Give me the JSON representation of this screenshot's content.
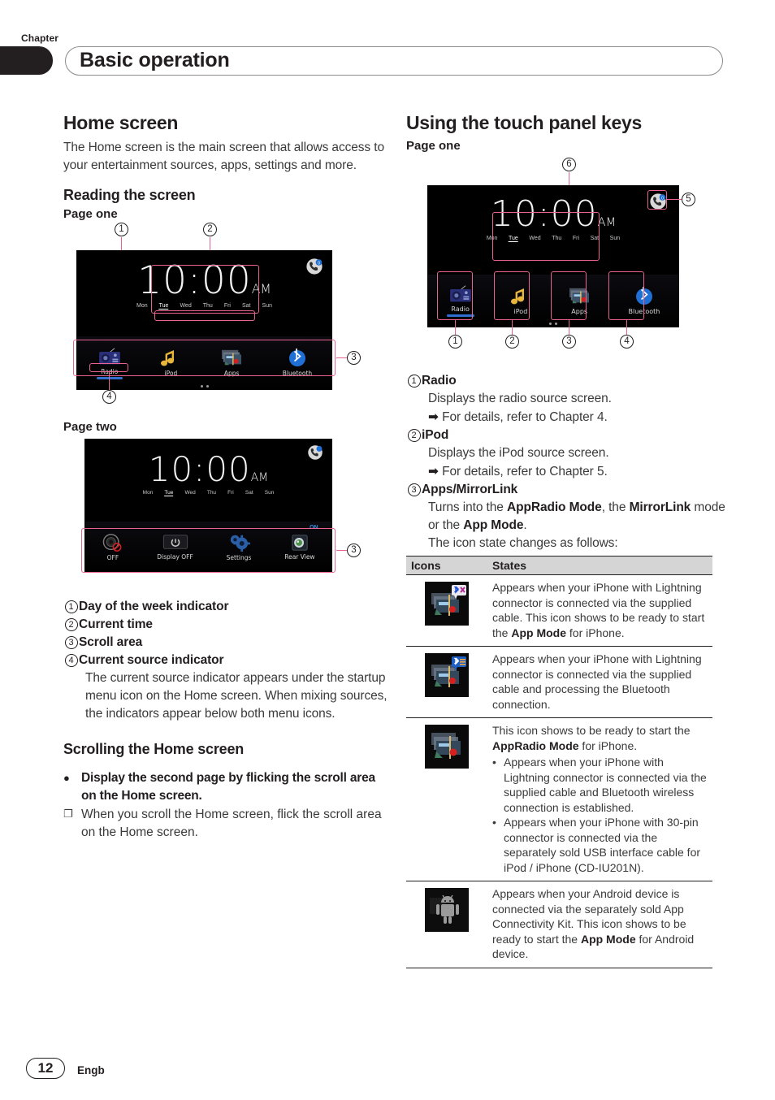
{
  "header": {
    "chapter_label": "Chapter",
    "title": "Basic operation"
  },
  "footer": {
    "page_number": "12",
    "language_code": "Engb"
  },
  "left_column": {
    "section_title": "Home screen",
    "intro": "The Home screen is the main screen that allows access to your entertainment sources, apps, settings and more.",
    "reading_heading": "Reading the screen",
    "page_one_label": "Page one",
    "page_two_label": "Page two",
    "callouts": [
      "1",
      "2",
      "3",
      "4"
    ],
    "definitions": [
      {
        "num": "1",
        "term": "Day of the week indicator",
        "desc": ""
      },
      {
        "num": "2",
        "term": "Current time",
        "desc": ""
      },
      {
        "num": "3",
        "term": "Scroll area",
        "desc": ""
      },
      {
        "num": "4",
        "term": "Current source indicator",
        "desc": "The current source indicator appears under the startup menu icon on the Home screen. When mixing sources, the indicators appear below both menu icons."
      }
    ],
    "scrolling_heading": "Scrolling the Home screen",
    "scroll_bullet": "Display the second page by flicking the scroll area on the Home screen.",
    "scroll_note": "When you scroll the Home screen, flick the scroll area on the Home screen."
  },
  "right_column": {
    "section_title": "Using the touch panel keys",
    "page_one_label": "Page one",
    "callouts": [
      "1",
      "2",
      "3",
      "4",
      "5",
      "6"
    ],
    "definitions": [
      {
        "num": "1",
        "term": "Radio",
        "desc": "Displays the radio source screen.",
        "ref": "For details, refer to Chapter 4."
      },
      {
        "num": "2",
        "term": "iPod",
        "desc": "Displays the iPod source screen.",
        "ref": "For details, refer to Chapter 5."
      },
      {
        "num": "3",
        "term": "Apps/MirrorLink",
        "desc": "",
        "ref": ""
      }
    ],
    "apps_desc": {
      "line1_a": "Turns into the ",
      "line1_b": "AppRadio Mode",
      "line1_c": ", the ",
      "line2_a": "MirrorLink",
      "line2_b": " mode or the ",
      "line2_c": "App Mode",
      "line2_d": ".",
      "line3": "The icon state changes as follows:"
    },
    "table": {
      "columns": [
        "Icons",
        "States"
      ],
      "rows": [
        {
          "icon": "apps-icon-bt-disconnected",
          "text_parts": [
            {
              "t": "Appears when your iPhone with Lightning connector is connected via the supplied cable. This icon shows to be ready to start the ",
              "bold": false
            },
            {
              "t": "App Mode",
              "bold": true
            },
            {
              "t": " for iPhone.",
              "bold": false
            }
          ],
          "bullets": []
        },
        {
          "icon": "apps-icon-bt-processing",
          "text_parts": [
            {
              "t": "Appears when your iPhone with Lightning connector is connected via the supplied cable and processing the Bluetooth connection.",
              "bold": false
            }
          ],
          "bullets": []
        },
        {
          "icon": "apps-icon-ready",
          "text_parts": [
            {
              "t": "This icon shows to be ready to start the ",
              "bold": false
            },
            {
              "t": "AppRadio Mode",
              "bold": true
            },
            {
              "t": " for iPhone.",
              "bold": false
            }
          ],
          "bullets": [
            "Appears when your iPhone with Lightning connector is connected via the supplied cable and Bluetooth wireless connection is established.",
            "Appears when your iPhone with 30-pin connector is connected via the separately sold USB interface cable for iPod / iPhone (CD-IU201N)."
          ]
        },
        {
          "icon": "android-icon",
          "text_parts": [
            {
              "t": "Appears when your Android device is connected via the separately sold App Connectivity Kit. This icon shows to be ready to start the ",
              "bold": false
            },
            {
              "t": "App Mode",
              "bold": true
            },
            {
              "t": " for Android device.",
              "bold": false
            }
          ],
          "bullets": []
        }
      ]
    }
  },
  "device_screens": {
    "clock": {
      "time": "10:00",
      "ampm": "AM"
    },
    "days": [
      "Mon",
      "Tue",
      "Wed",
      "Thu",
      "Fri",
      "Sat",
      "Sun"
    ],
    "active_day": "Tue",
    "page_one_dock": [
      {
        "label": "Radio",
        "icon": "radio-icon"
      },
      {
        "label": "iPod",
        "icon": "music-note-icon"
      },
      {
        "label": "Apps",
        "icon": "apps-icon"
      },
      {
        "label": "Bluetooth",
        "icon": "bluetooth-icon"
      }
    ],
    "page_two_dock": [
      {
        "label": "OFF",
        "icon": "speaker-off-icon"
      },
      {
        "label": "Display OFF",
        "icon": "display-off-icon"
      },
      {
        "label": "Settings",
        "icon": "gear-icon"
      },
      {
        "label": "Rear View",
        "icon": "rear-view-icon",
        "badge": "ON"
      }
    ],
    "phone_badge_count": "0"
  },
  "colors": {
    "highlight": "#e8638f",
    "ink": "#231f20",
    "body_text": "#3a3a3a",
    "table_header_bg": "#d5d5d5",
    "bluetooth_blue": "#1f6fd4",
    "source_bar": "#2f6fd0"
  }
}
